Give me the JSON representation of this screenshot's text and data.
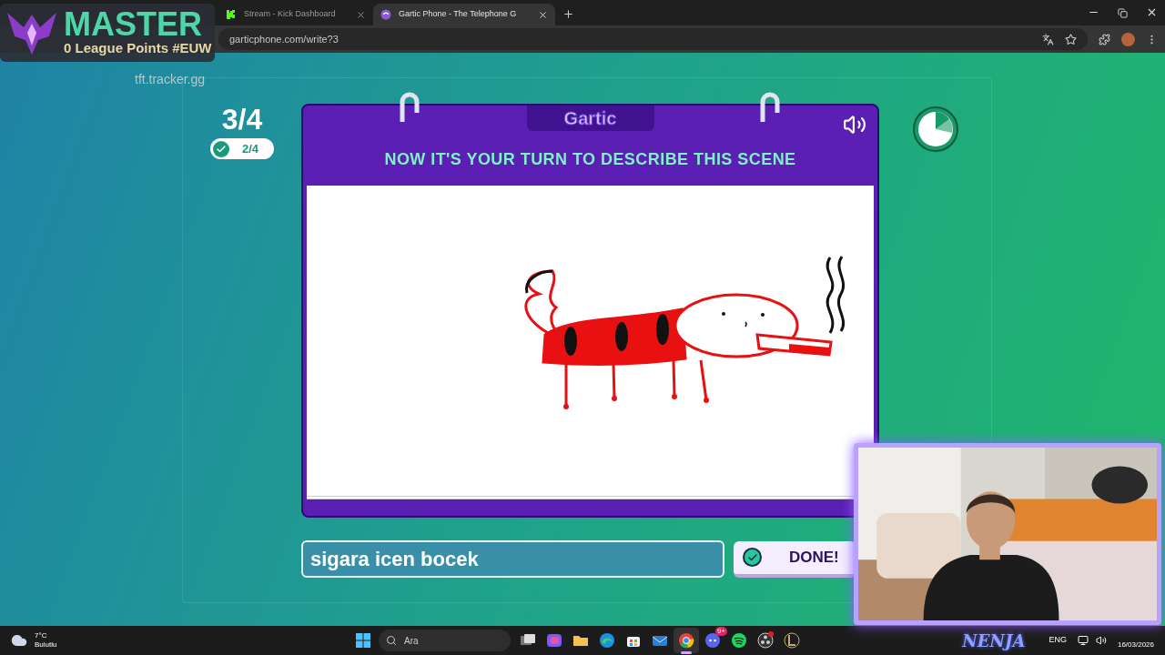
{
  "browser": {
    "tabs": [
      {
        "title": "Stream - Kick Dashboard",
        "kind": "kick",
        "selected": false
      },
      {
        "title": "Gartic Phone - The Telephone G",
        "kind": "gartic",
        "selected": true
      }
    ],
    "url": "garticphone.com/write?3"
  },
  "stream_overlay": {
    "rank": "MASTER",
    "points": "0 League Points #EUW",
    "source": "tft.tracker.gg"
  },
  "game": {
    "round": "3/4",
    "done_count": "2/4",
    "logo": "Gartic",
    "instruction": "NOW IT'S YOUR TURN TO DESCRIBE THIS SCENE",
    "answer": "sigara icen bocek",
    "done_button": "DONE!"
  },
  "taskbar": {
    "temperature": "7°C",
    "weather": "Bulutlu",
    "search_placeholder": "Ara",
    "apps": [
      {
        "kind": "taskview",
        "selected": false
      },
      {
        "kind": "copilot",
        "selected": false
      },
      {
        "kind": "folder",
        "selected": false
      },
      {
        "kind": "edge",
        "selected": false
      },
      {
        "kind": "store",
        "selected": false
      },
      {
        "kind": "mail",
        "selected": false
      },
      {
        "kind": "chrome",
        "selected": true
      },
      {
        "kind": "discord",
        "selected": false,
        "badge": "9+"
      },
      {
        "kind": "spotify",
        "selected": false
      },
      {
        "kind": "obs",
        "selected": false
      },
      {
        "kind": "league",
        "selected": false
      }
    ],
    "brand": "NENJA",
    "language": "ENG",
    "date": "16/03/2026"
  }
}
